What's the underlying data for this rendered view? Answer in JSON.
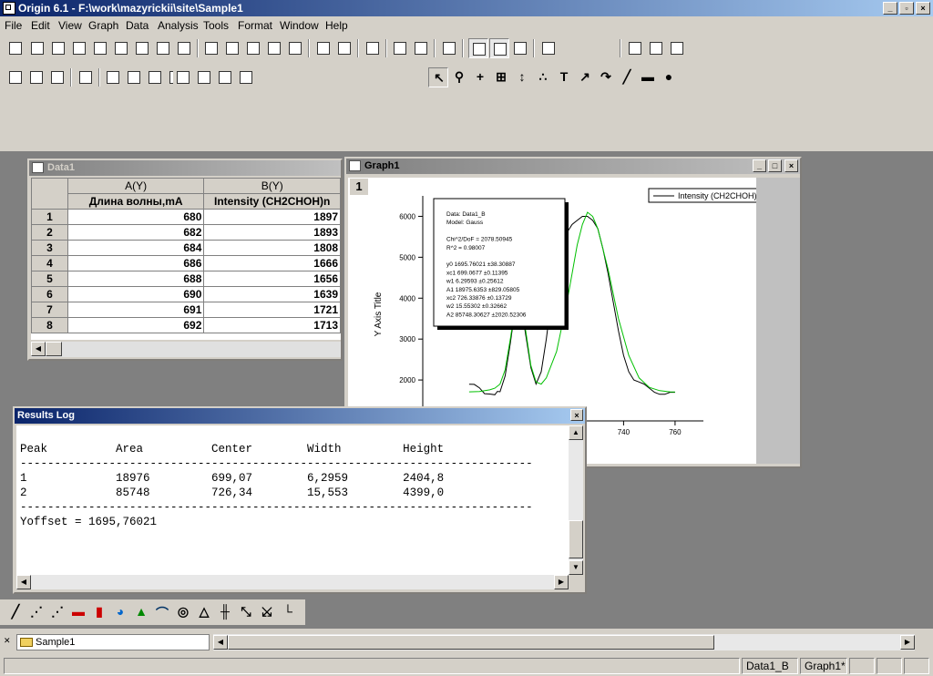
{
  "app": {
    "title": "Origin 6.1 - F:\\work\\mazyrickii\\site\\Sample1"
  },
  "menu": [
    "File",
    "Edit",
    "View",
    "Graph",
    "Data",
    "Analysis",
    "Tools",
    "Format",
    "Window",
    "Help"
  ],
  "data_window": {
    "title": "Data1",
    "col_a_name": "A(Y)",
    "col_b_name": "B(Y)",
    "col_a_label": "Длина волны,mA",
    "col_b_label": "Intensity (CH2CHOH)n",
    "rows": [
      {
        "n": "1",
        "a": "680",
        "b": "1897"
      },
      {
        "n": "2",
        "a": "682",
        "b": "1893"
      },
      {
        "n": "3",
        "a": "684",
        "b": "1808"
      },
      {
        "n": "4",
        "a": "686",
        "b": "1666"
      },
      {
        "n": "5",
        "a": "688",
        "b": "1656"
      },
      {
        "n": "6",
        "a": "690",
        "b": "1639"
      },
      {
        "n": "7",
        "a": "691",
        "b": "1721"
      },
      {
        "n": "8",
        "a": "692",
        "b": "1713"
      }
    ]
  },
  "graph_window": {
    "title": "Graph1",
    "layer": "1",
    "legend": "Intensity (CH2CHOH)n",
    "y_axis_title": "Y Axis Title",
    "fit_box": [
      "Data: Data1_B",
      "Model: Gauss",
      "",
      "Chi^2/DoF      = 2078.50945",
      "R^2    = 0.98007",
      "",
      "y0      1695.76021    ±38.30887",
      "xc1     699.0677       ±0.11395",
      "w1      6.29593         ±0.25612",
      "A1      18975.6353    ±829.05805",
      "xc2     726.33876      ±0.13729",
      "w2      15.55302       ±0.32662",
      "A2      85748.30627   ±2020.52306"
    ]
  },
  "chart_data": {
    "type": "line",
    "xlim": [
      662,
      771
    ],
    "ylim": [
      1000,
      6500
    ],
    "yticks": [
      2000,
      3000,
      4000,
      5000,
      6000
    ],
    "xticks": [
      740,
      760
    ],
    "series": [
      {
        "name": "Intensity (CH2CHOH)n",
        "color": "#000000",
        "x": [
          680,
          682,
          684,
          686,
          688,
          690,
          691,
          692,
          694,
          696,
          698,
          699,
          700,
          702,
          704,
          706,
          708,
          710,
          712,
          714,
          716,
          718,
          720,
          722,
          724,
          726,
          728,
          730,
          732,
          734,
          736,
          738,
          740,
          742,
          744,
          746,
          748,
          750,
          752,
          754,
          756,
          758,
          760
        ],
        "y": [
          1897,
          1893,
          1808,
          1666,
          1656,
          1639,
          1721,
          1713,
          2100,
          2900,
          3800,
          4000,
          3900,
          3100,
          2300,
          1900,
          2200,
          3000,
          4000,
          4800,
          5300,
          5600,
          5800,
          5900,
          6000,
          6000,
          5900,
          5700,
          5200,
          4600,
          3900,
          3200,
          2600,
          2200,
          2000,
          1950,
          1900,
          1800,
          1700,
          1650,
          1650,
          1700,
          1700
        ]
      },
      {
        "name": "",
        "color": "#00c000",
        "x": [
          680,
          684,
          688,
          690,
          692,
          694,
          696,
          698,
          699,
          700,
          702,
          704,
          706,
          708,
          710,
          714,
          718,
          720,
          722,
          724,
          726,
          728,
          730,
          734,
          738,
          742,
          746,
          750,
          754,
          758,
          760
        ],
        "y": [
          1710,
          1720,
          1760,
          1800,
          1900,
          2250,
          3000,
          3800,
          4100,
          4000,
          3200,
          2350,
          1950,
          1900,
          2050,
          2700,
          3900,
          4600,
          5300,
          5800,
          6100,
          6000,
          5700,
          4700,
          3500,
          2600,
          2050,
          1820,
          1740,
          1710,
          1705
        ]
      }
    ]
  },
  "results_log": {
    "title": "Results Log",
    "lines": [
      "",
      "Peak          Area          Center        Width         Height",
      "---------------------------------------------------------------------------",
      "1             18976         699,07        6,2959        2404,8",
      "2             85748         726,34        15,553        4399,0",
      "---------------------------------------------------------------------------",
      "Yoffset = 1695,76021"
    ]
  },
  "taskbar": {
    "tab": "Sample1"
  },
  "status": {
    "cell1": "Data1_B",
    "cell2": "Graph1*"
  }
}
